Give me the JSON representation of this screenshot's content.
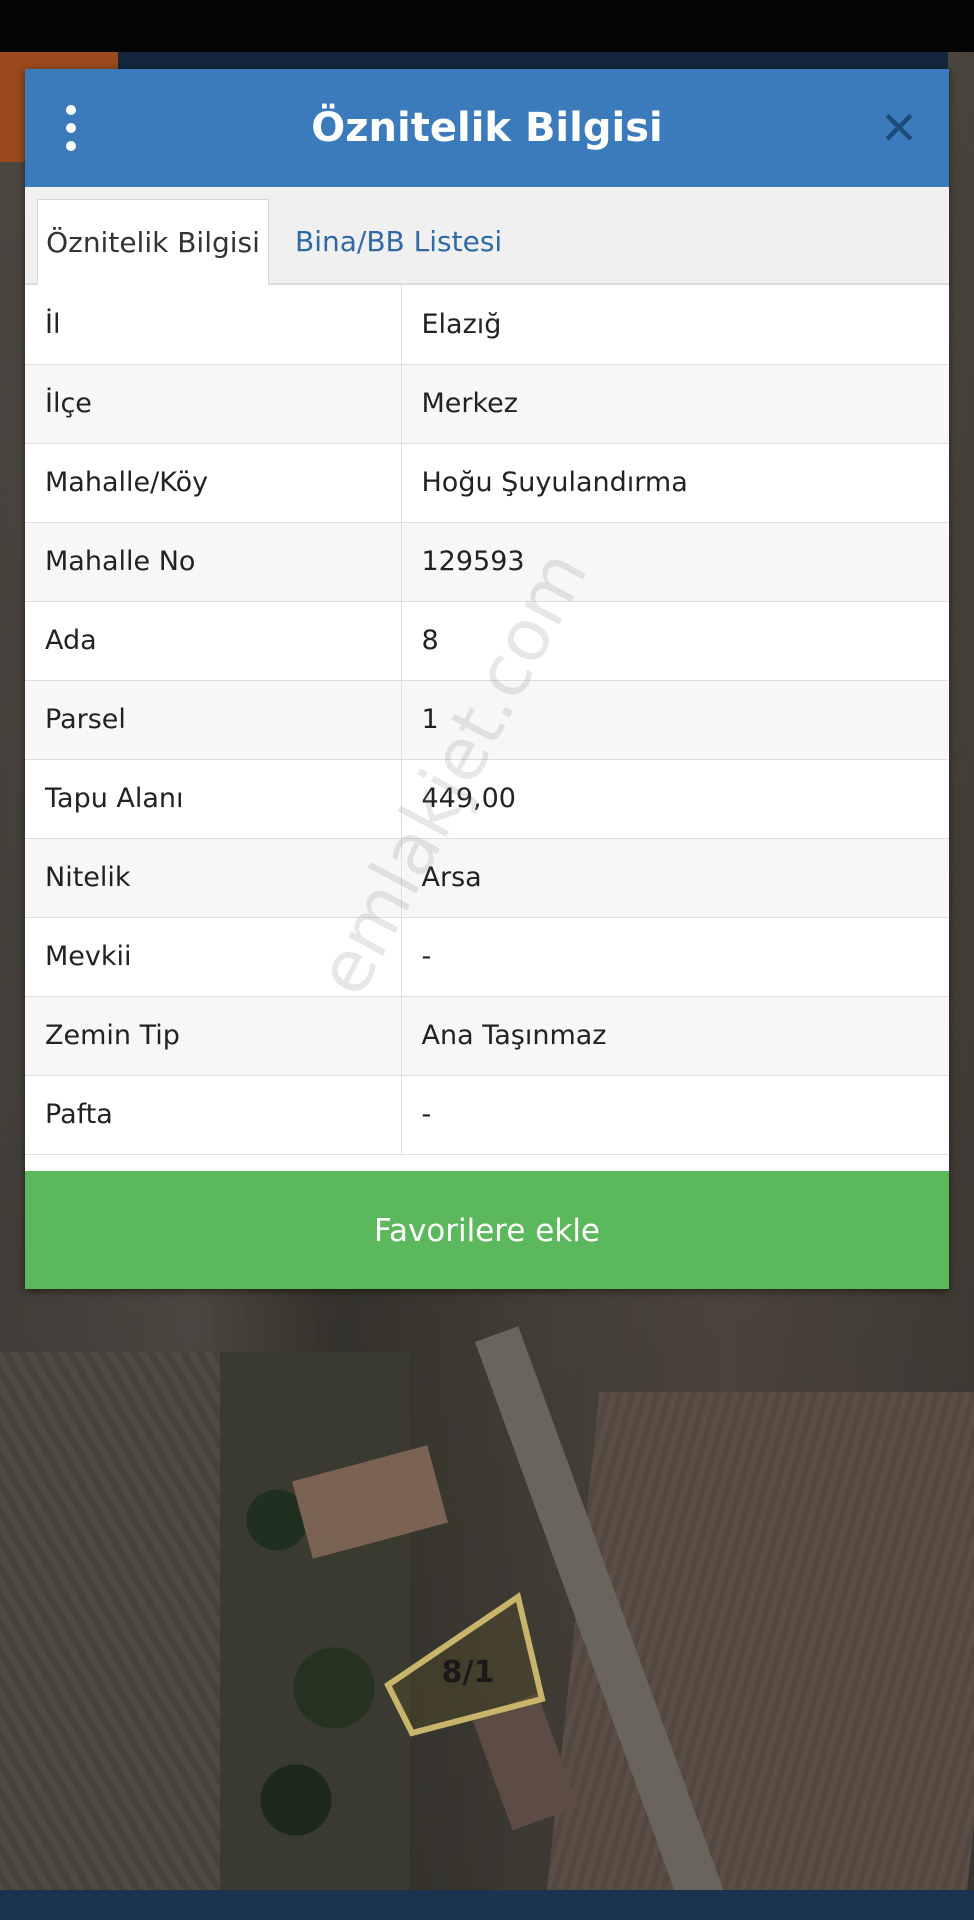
{
  "dialog": {
    "title": "Öznitelik Bilgisi",
    "menu_icon": "kebab-menu-icon",
    "close_icon": "close-icon"
  },
  "tabs": [
    {
      "label": "Öznitelik Bilgisi",
      "active": true
    },
    {
      "label": "Bina/BB Listesi",
      "active": false
    }
  ],
  "attributes": [
    {
      "key": "İl",
      "value": "Elazığ"
    },
    {
      "key": "İlçe",
      "value": "Merkez"
    },
    {
      "key": "Mahalle/Köy",
      "value": "Hoğu Şuyulandırma"
    },
    {
      "key": "Mahalle No",
      "value": "129593"
    },
    {
      "key": "Ada",
      "value": "8"
    },
    {
      "key": "Parsel",
      "value": "1"
    },
    {
      "key": "Tapu Alanı",
      "value": "449,00"
    },
    {
      "key": "Nitelik",
      "value": "Arsa"
    },
    {
      "key": "Mevkii",
      "value": "-"
    },
    {
      "key": "Zemin Tip",
      "value": "Ana Taşınmaz"
    },
    {
      "key": "Pafta",
      "value": "-"
    }
  ],
  "actions": {
    "favorite_label": "Favorilere ekle"
  },
  "watermark": "emlakjet.com",
  "map": {
    "parcel_label": "8/1"
  },
  "colors": {
    "header": "#3c7bbb",
    "button": "#5cb85c",
    "tab_link": "#2f6aa4"
  }
}
